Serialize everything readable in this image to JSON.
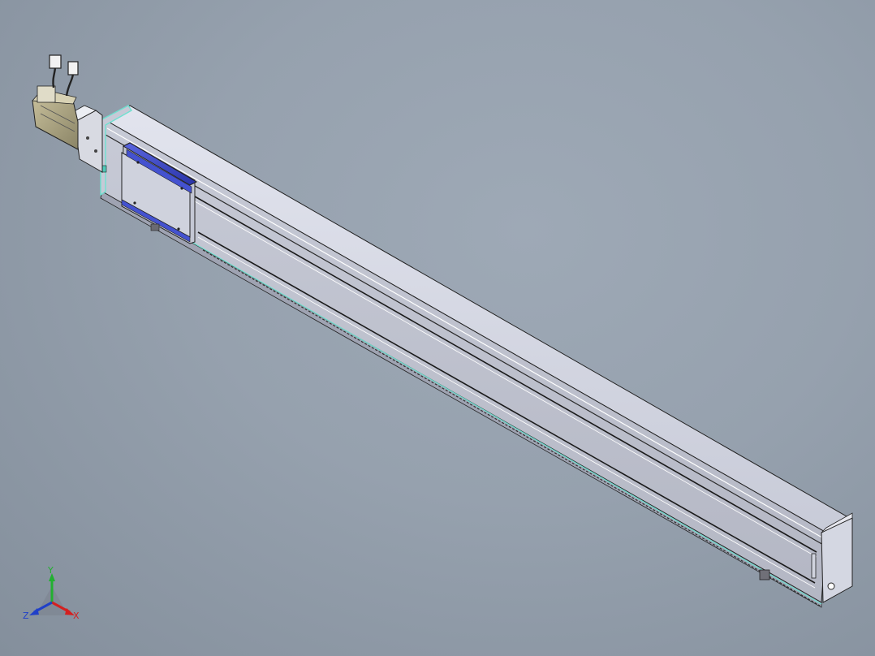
{
  "triad": {
    "x_label": "X",
    "y_label": "Y",
    "z_label": "Z",
    "x_color": "#d42020",
    "y_color": "#22b030",
    "z_color": "#2040c8"
  },
  "carriage_logo": "",
  "colors": {
    "background": "#96a1ae",
    "body": "#c9ccd8",
    "top_face": "#dadce8",
    "edge": "#1a1a1a",
    "accent": "#6fe0d0",
    "carriage_plate": "#3a46c8"
  }
}
